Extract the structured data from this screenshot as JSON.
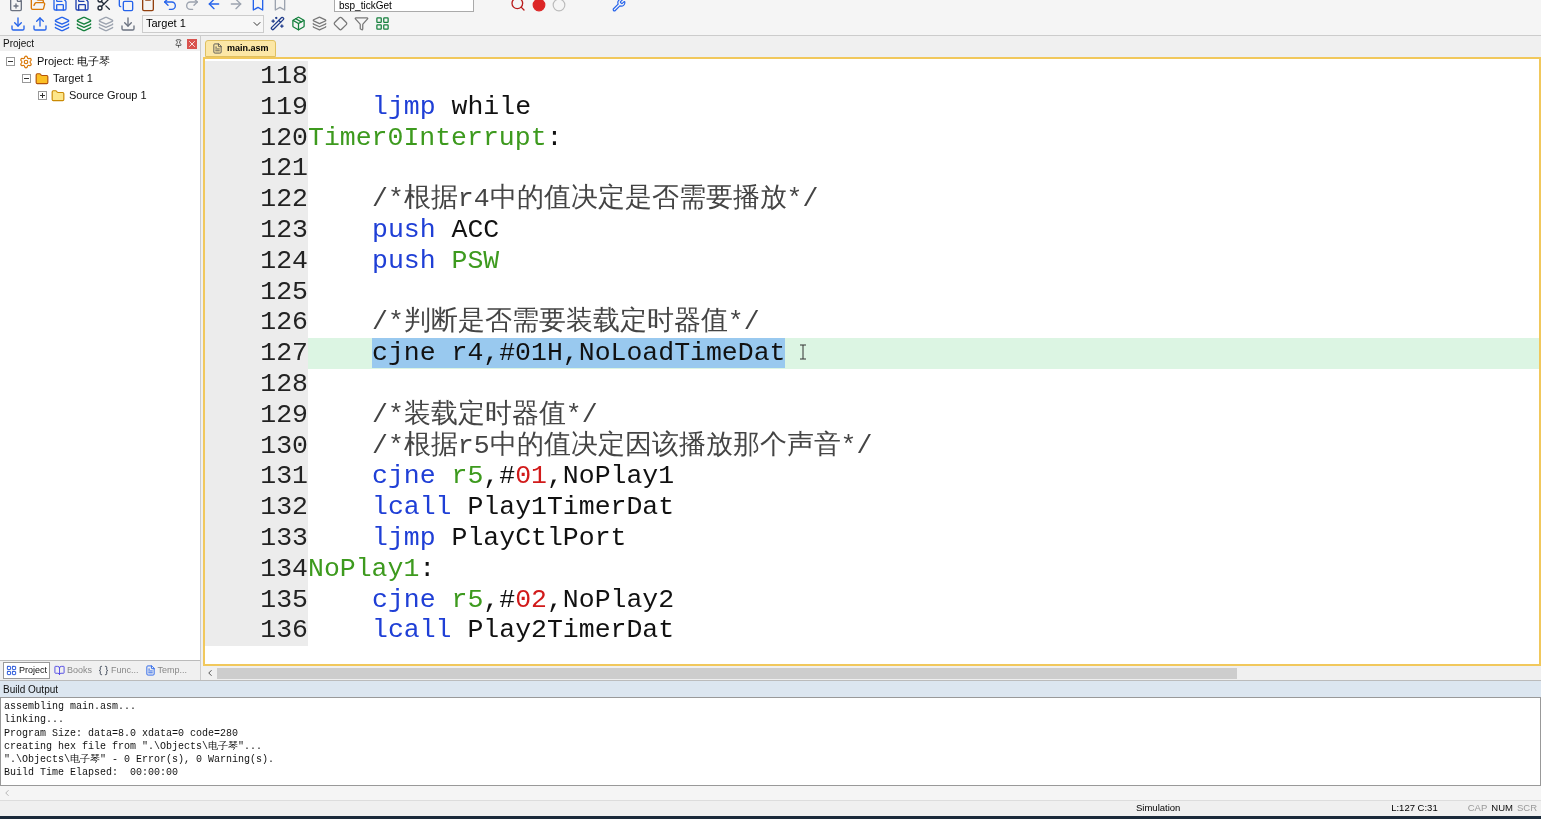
{
  "toolbar": {
    "function_combo": "bsp_tickGet",
    "target_combo": "Target 1"
  },
  "project_panel": {
    "title": "Project",
    "tree": [
      {
        "label": "Project: 电子琴",
        "kind": "project",
        "expanded": true,
        "children": [
          {
            "label": "Target 1",
            "kind": "target",
            "expanded": true,
            "children": [
              {
                "label": "Source Group 1",
                "kind": "group",
                "expanded": false
              }
            ]
          }
        ]
      }
    ],
    "tabs": [
      {
        "label": "Project",
        "selected": true
      },
      {
        "label": "Books",
        "selected": false
      },
      {
        "label": "Func...",
        "selected": false
      },
      {
        "label": "Temp...",
        "selected": false
      }
    ]
  },
  "editor": {
    "tabs": [
      {
        "label": "main.asm",
        "selected": true
      }
    ],
    "lines": [
      {
        "num": "118",
        "selected": false
      },
      {
        "num": "119",
        "selected": false,
        "indent": true,
        "tokens": [
          {
            "t": "ljmp",
            "kind": "keyword"
          },
          {
            "t": " while",
            "kind": "plain"
          }
        ]
      },
      {
        "num": "120",
        "selected": false,
        "indent": false,
        "tokens": [
          {
            "t": "Timer0Interrupt",
            "kind": "label"
          },
          {
            "t": ":",
            "kind": "plain"
          }
        ]
      },
      {
        "num": "121",
        "selected": false
      },
      {
        "num": "122",
        "selected": false,
        "indent": true,
        "tokens": [
          {
            "t": "/*根据r4中的值决定是否需要播放*/",
            "kind": "comment"
          }
        ]
      },
      {
        "num": "123",
        "selected": false,
        "indent": true,
        "tokens": [
          {
            "t": "push",
            "kind": "keyword"
          },
          {
            "t": " ACC",
            "kind": "plain"
          }
        ]
      },
      {
        "num": "124",
        "selected": false,
        "indent": true,
        "tokens": [
          {
            "t": "push ",
            "kind": "keyword"
          },
          {
            "t": "PSW",
            "kind": "label"
          }
        ]
      },
      {
        "num": "125",
        "selected": false
      },
      {
        "num": "126",
        "selected": false,
        "indent": true,
        "tokens": [
          {
            "t": "/*判断是否需要装载定时器值*/",
            "kind": "comment"
          }
        ]
      },
      {
        "num": "127",
        "selected": true,
        "indent": true,
        "tokens": [
          {
            "t": "cjne r4,#01H,NoLoadTimeDat",
            "kind": "plain"
          }
        ]
      },
      {
        "num": "128",
        "selected": false
      },
      {
        "num": "129",
        "selected": false,
        "indent": true,
        "tokens": [
          {
            "t": "/*装载定时器值*/",
            "kind": "comment"
          }
        ]
      },
      {
        "num": "130",
        "selected": false,
        "indent": true,
        "tokens": [
          {
            "t": "/*根据r5中的值决定因该播放那个声音*/",
            "kind": "comment"
          }
        ]
      },
      {
        "num": "131",
        "selected": false,
        "indent": true,
        "tokens": [
          {
            "t": "cjne ",
            "kind": "keyword"
          },
          {
            "t": "r5",
            "kind": "label"
          },
          {
            "t": ",#",
            "kind": "plain"
          },
          {
            "t": "01",
            "kind": "number"
          },
          {
            "t": ",NoPlay1",
            "kind": "plain"
          }
        ]
      },
      {
        "num": "132",
        "selected": false,
        "indent": true,
        "tokens": [
          {
            "t": "lcall",
            "kind": "keyword"
          },
          {
            "t": " Play1TimerDat",
            "kind": "plain"
          }
        ]
      },
      {
        "num": "133",
        "selected": false,
        "indent": true,
        "tokens": [
          {
            "t": "ljmp",
            "kind": "keyword"
          },
          {
            "t": " PlayCtlPort",
            "kind": "plain"
          }
        ]
      },
      {
        "num": "134",
        "selected": false,
        "indent": false,
        "tokens": [
          {
            "t": "NoPlay1",
            "kind": "label"
          },
          {
            "t": ":",
            "kind": "plain"
          }
        ]
      },
      {
        "num": "135",
        "selected": false,
        "indent": true,
        "tokens": [
          {
            "t": "cjne ",
            "kind": "keyword"
          },
          {
            "t": "r5",
            "kind": "label"
          },
          {
            "t": ",#",
            "kind": "plain"
          },
          {
            "t": "02",
            "kind": "number"
          },
          {
            "t": ",NoPlay2",
            "kind": "plain"
          }
        ]
      },
      {
        "num": "136",
        "selected": false,
        "indent": true,
        "tokens": [
          {
            "t": "lcall",
            "kind": "keyword"
          },
          {
            "t": " Play2TimerDat",
            "kind": "plain"
          }
        ]
      }
    ]
  },
  "build_output": {
    "title": "Build Output",
    "lines": [
      "assembling main.asm...",
      "linking...",
      "Program Size: data=8.0 xdata=0 code=280",
      "creating hex file from \".\\Objects\\电子琴\"...",
      "\".\\Objects\\电子琴\" - 0 Error(s), 0 Warning(s).",
      "Build Time Elapsed:  00:00:00"
    ]
  },
  "status_bar": {
    "mode": "Simulation",
    "position": "L:127 C:31",
    "indicators": [
      {
        "label": "CAP",
        "on": false
      },
      {
        "label": "NUM",
        "on": true
      },
      {
        "label": "SCR",
        "on": false
      }
    ]
  }
}
